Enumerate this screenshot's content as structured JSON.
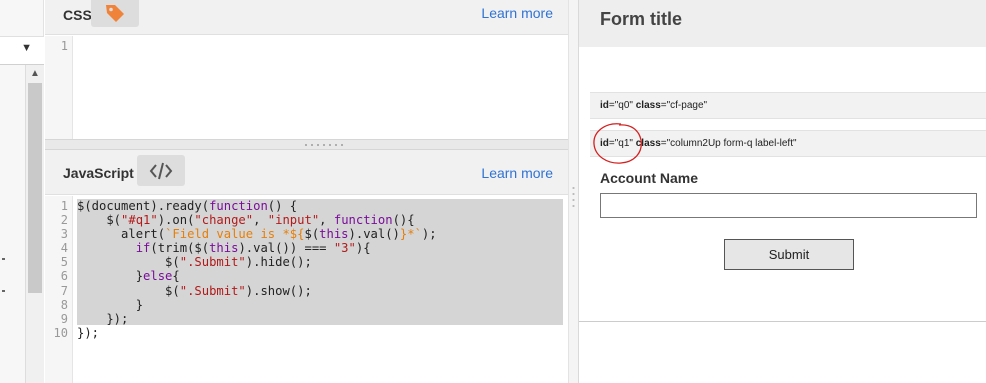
{
  "css_panel": {
    "title": "CSS",
    "learn_more": "Learn more",
    "line_numbers": [
      "1"
    ]
  },
  "js_panel": {
    "title": "JavaScript",
    "learn_more": "Learn more",
    "line_numbers": [
      "1",
      "2",
      "3",
      "4",
      "5",
      "6",
      "7",
      "8",
      "9",
      "10"
    ],
    "code": [
      [
        {
          "t": "$(document).ready(",
          "c": ""
        },
        {
          "t": "function",
          "c": "kw"
        },
        {
          "t": "() {",
          "c": ""
        }
      ],
      [
        {
          "t": "    $(",
          "c": ""
        },
        {
          "t": "\"#q1\"",
          "c": "str"
        },
        {
          "t": ").on(",
          "c": ""
        },
        {
          "t": "\"change\"",
          "c": "str"
        },
        {
          "t": ", ",
          "c": ""
        },
        {
          "t": "\"input\"",
          "c": "str"
        },
        {
          "t": ", ",
          "c": ""
        },
        {
          "t": "function",
          "c": "kw"
        },
        {
          "t": "(){",
          "c": ""
        }
      ],
      [
        {
          "t": "      alert(",
          "c": ""
        },
        {
          "t": "`Field value is *${",
          "c": "tpl"
        },
        {
          "t": "$(",
          "c": ""
        },
        {
          "t": "this",
          "c": "kw"
        },
        {
          "t": ").val()",
          "c": ""
        },
        {
          "t": "}*`",
          "c": "tpl"
        },
        {
          "t": ");",
          "c": ""
        }
      ],
      [
        {
          "t": "        ",
          "c": ""
        },
        {
          "t": "if",
          "c": "kw"
        },
        {
          "t": "(trim($(",
          "c": ""
        },
        {
          "t": "this",
          "c": "kw"
        },
        {
          "t": ").val()) === ",
          "c": ""
        },
        {
          "t": "\"3\"",
          "c": "str"
        },
        {
          "t": "){",
          "c": ""
        }
      ],
      [
        {
          "t": "            $(",
          "c": ""
        },
        {
          "t": "\".Submit\"",
          "c": "str"
        },
        {
          "t": ").hide();",
          "c": ""
        }
      ],
      [
        {
          "t": "        }",
          "c": ""
        },
        {
          "t": "else",
          "c": "kw"
        },
        {
          "t": "{",
          "c": ""
        }
      ],
      [
        {
          "t": "            $(",
          "c": ""
        },
        {
          "t": "\".Submit\"",
          "c": "str"
        },
        {
          "t": ").show();",
          "c": ""
        }
      ],
      [
        {
          "t": "        }",
          "c": ""
        }
      ],
      [
        {
          "t": "    });",
          "c": ""
        }
      ],
      [
        {
          "t": "});",
          "c": ""
        }
      ]
    ]
  },
  "preview": {
    "form_title": "Form title",
    "bar1": {
      "id_attr": "id",
      "id_value": "=\"q0\" ",
      "class_attr": "class",
      "class_value": "=\"cf-page\""
    },
    "bar2": {
      "id_attr": "id",
      "id_value": "=\"q1\" ",
      "class_attr": "class",
      "class_value": "=\"column2Up form-q label-left\""
    },
    "account_label": "Account Name",
    "account_value": "",
    "submit_label": "Submit"
  },
  "icons": {
    "css_tag": "tag-icon",
    "js_code": "code-icon",
    "dropdown": "caret-down-icon",
    "scroll_up": "chevron-up-icon"
  },
  "colors": {
    "link": "#2f73d6",
    "tag_icon": "#f0833a",
    "annotation": "#d42020",
    "keyword": "#7a0d9a",
    "string": "#b21a1a",
    "template": "#e57f0b"
  }
}
